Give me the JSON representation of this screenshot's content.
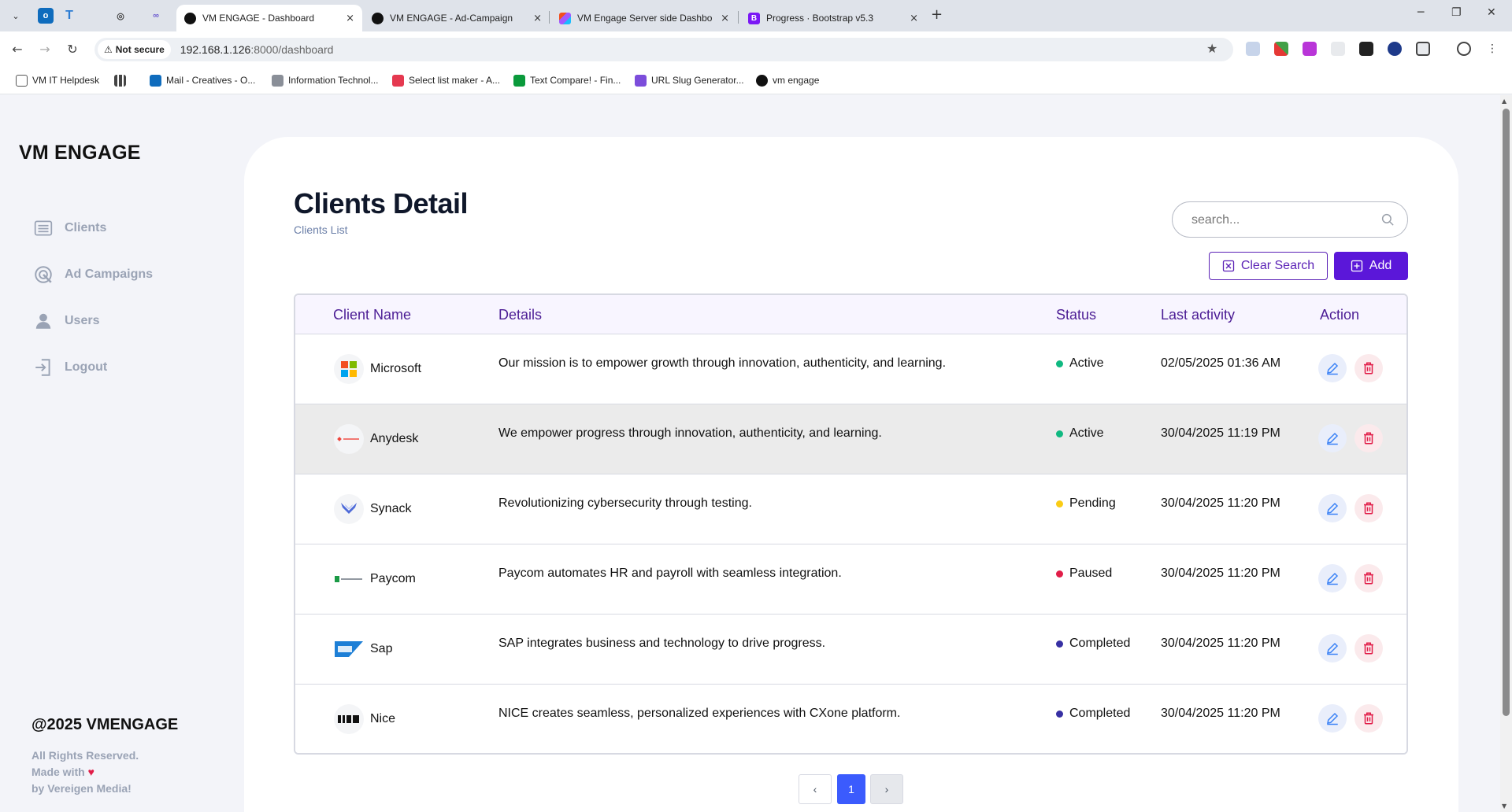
{
  "browser": {
    "tabs": [
      {
        "title": "VM ENGAGE - Dashboard",
        "active": true
      },
      {
        "title": "VM ENGAGE - Ad-Campaign",
        "active": false
      },
      {
        "title": "VM Engage Server side Dashbo",
        "active": false
      },
      {
        "title": "Progress · Bootstrap v5.3",
        "active": false
      }
    ],
    "tab_close": "×",
    "new_tab": "+",
    "window_controls": {
      "minimize": "─",
      "restore": "❐",
      "close": "✕"
    },
    "security_label": "Not secure",
    "url_host": "192.168.1.126",
    "url_path": ":8000/dashboard",
    "bookmarks": [
      "VM IT Helpdesk",
      "Mail - Creatives - O...",
      "Information Technol...",
      "Select list maker - A...",
      "Text Compare! - Fin...",
      "URL Slug Generator...",
      "vm engage"
    ]
  },
  "sidebar": {
    "brand": "VM ENGAGE",
    "items": [
      {
        "label": "Clients",
        "icon": "list-icon"
      },
      {
        "label": "Ad Campaigns",
        "icon": "campaign-icon"
      },
      {
        "label": "Users",
        "icon": "user-icon"
      },
      {
        "label": "Logout",
        "icon": "logout-icon"
      }
    ],
    "footer": {
      "copyright": "@2025 VMENGAGE",
      "rights": "All Rights Reserved.",
      "made_with": "Made with",
      "heart": "♥",
      "by": "by Vereigen Media!"
    }
  },
  "main": {
    "title": "Clients Detail",
    "subtitle": "Clients List",
    "search_placeholder": "search...",
    "clear_search_label": "Clear Search",
    "add_label": "Add",
    "columns": [
      "Client Name",
      "Details",
      "Status",
      "Last activity",
      "Action"
    ],
    "rows": [
      {
        "name": "Microsoft",
        "details": "Our mission is to empower growth through innovation, authenticity, and learning.",
        "status": "Active",
        "status_color": "#10b981",
        "last_activity": "02/05/2025 01:36 AM"
      },
      {
        "name": "Anydesk",
        "details": "We empower progress through innovation, authenticity, and learning.",
        "status": "Active",
        "status_color": "#10b981",
        "last_activity": "30/04/2025 11:19 PM"
      },
      {
        "name": "Synack",
        "details": "Revolutionizing cybersecurity through testing.",
        "status": "Pending",
        "status_color": "#facc15",
        "last_activity": "30/04/2025 11:20 PM"
      },
      {
        "name": "Paycom",
        "details": "Paycom automates HR and payroll with seamless integration.",
        "status": "Paused",
        "status_color": "#e11d48",
        "last_activity": "30/04/2025 11:20 PM"
      },
      {
        "name": "Sap",
        "details": "SAP integrates business and technology to drive progress.",
        "status": "Completed",
        "status_color": "#3730a3",
        "last_activity": "30/04/2025 11:20 PM"
      },
      {
        "name": "Nice",
        "details": "NICE creates seamless, personalized experiences with CXone platform.",
        "status": "Completed",
        "status_color": "#3730a3",
        "last_activity": "30/04/2025 11:20 PM"
      }
    ],
    "pagination": {
      "prev": "‹",
      "current": "1",
      "next": "›"
    }
  },
  "colors": {
    "accent": "#5b17d9",
    "header_text": "#4c1d95",
    "page_active": "#3b5bfd"
  }
}
